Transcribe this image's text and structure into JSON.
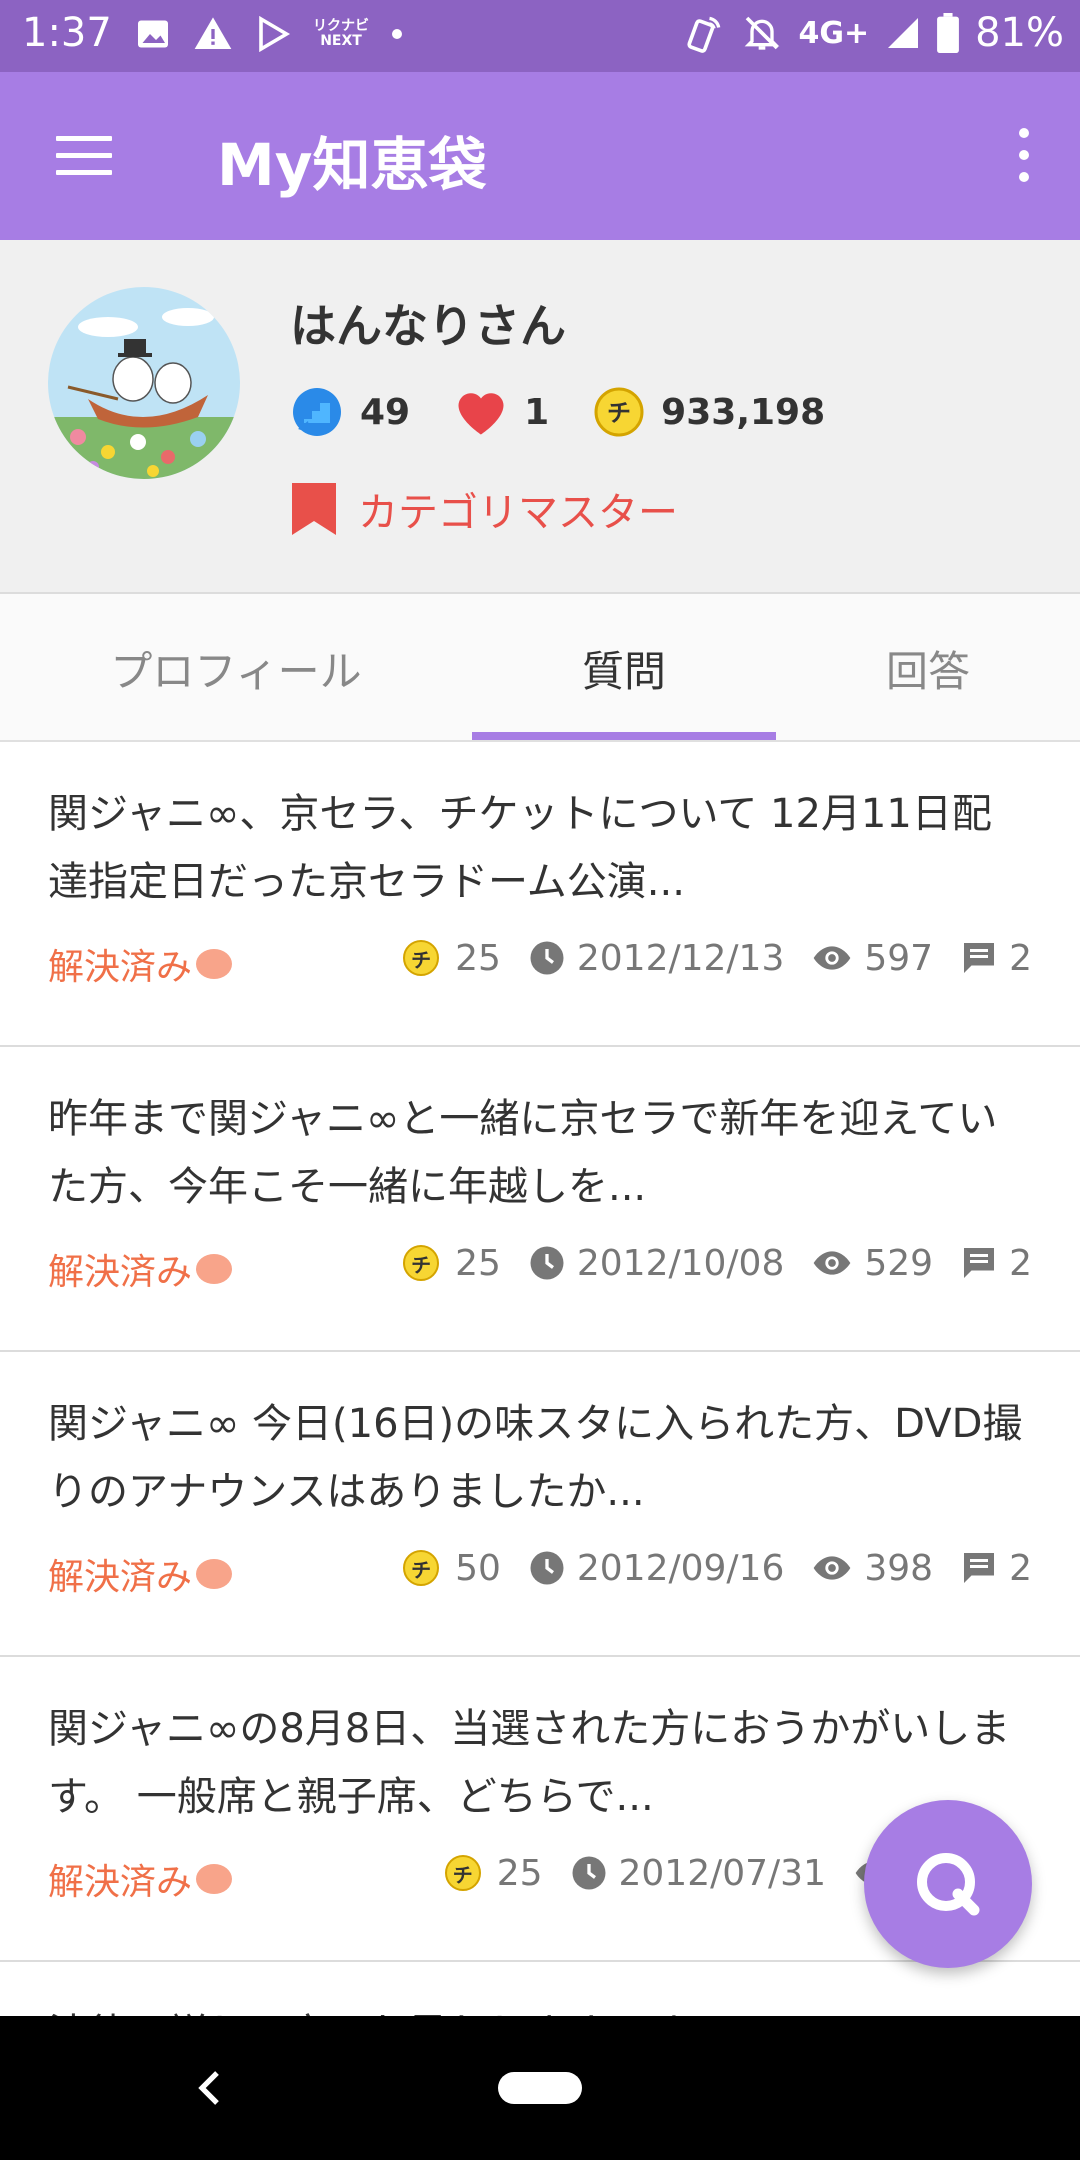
{
  "status_bar": {
    "time": "1:37",
    "network": "4G+",
    "battery": "81%",
    "next_logo": "NEXT",
    "next_logo_small": "リクナビ"
  },
  "app_bar": {
    "title": "My知恵袋"
  },
  "profile": {
    "username": "はんなりさん",
    "level": "49",
    "likes": "1",
    "coins": "933,198",
    "category_badge": "カテゴリマスター"
  },
  "tabs": [
    {
      "label": "プロフィール"
    },
    {
      "label": "質問"
    },
    {
      "label": "回答"
    }
  ],
  "questions": [
    {
      "title": "関ジャニ∞、京セラ、チケットについて 12月11日配達指定日だった京セラドーム公演...",
      "status": "解決済み",
      "coins": "25",
      "date": "2012/12/13",
      "views": "597",
      "answers": "2"
    },
    {
      "title": "昨年まで関ジャニ∞と一緒に京セラで新年を迎えていた方、今年こそ一緒に年越しを...",
      "status": "解決済み",
      "coins": "25",
      "date": "2012/10/08",
      "views": "529",
      "answers": "2"
    },
    {
      "title": "関ジャニ∞ 今日(16日)の味スタに入られた方、DVD撮りのアナウンスはありましたか...",
      "status": "解決済み",
      "coins": "50",
      "date": "2012/09/16",
      "views": "398",
      "answers": "2"
    },
    {
      "title": "関ジャニ∞の8月8日、当選された方におうかがいします。 一般席と親子席、どちらで...",
      "status": "解決済み",
      "coins": "25",
      "date": "2012/07/31",
      "views": "",
      "answers": ""
    },
    {
      "title": "法律に詳しい方にお尋ねします。 あるコンサ",
      "status": "",
      "coins": "",
      "date": "",
      "views": "",
      "answers": ""
    }
  ],
  "coin_glyph": "チ",
  "colors": {
    "app_bar": "#a77de4",
    "status_bar": "#8c63c2",
    "resolved": "#f07048",
    "category": "#e8504a"
  }
}
